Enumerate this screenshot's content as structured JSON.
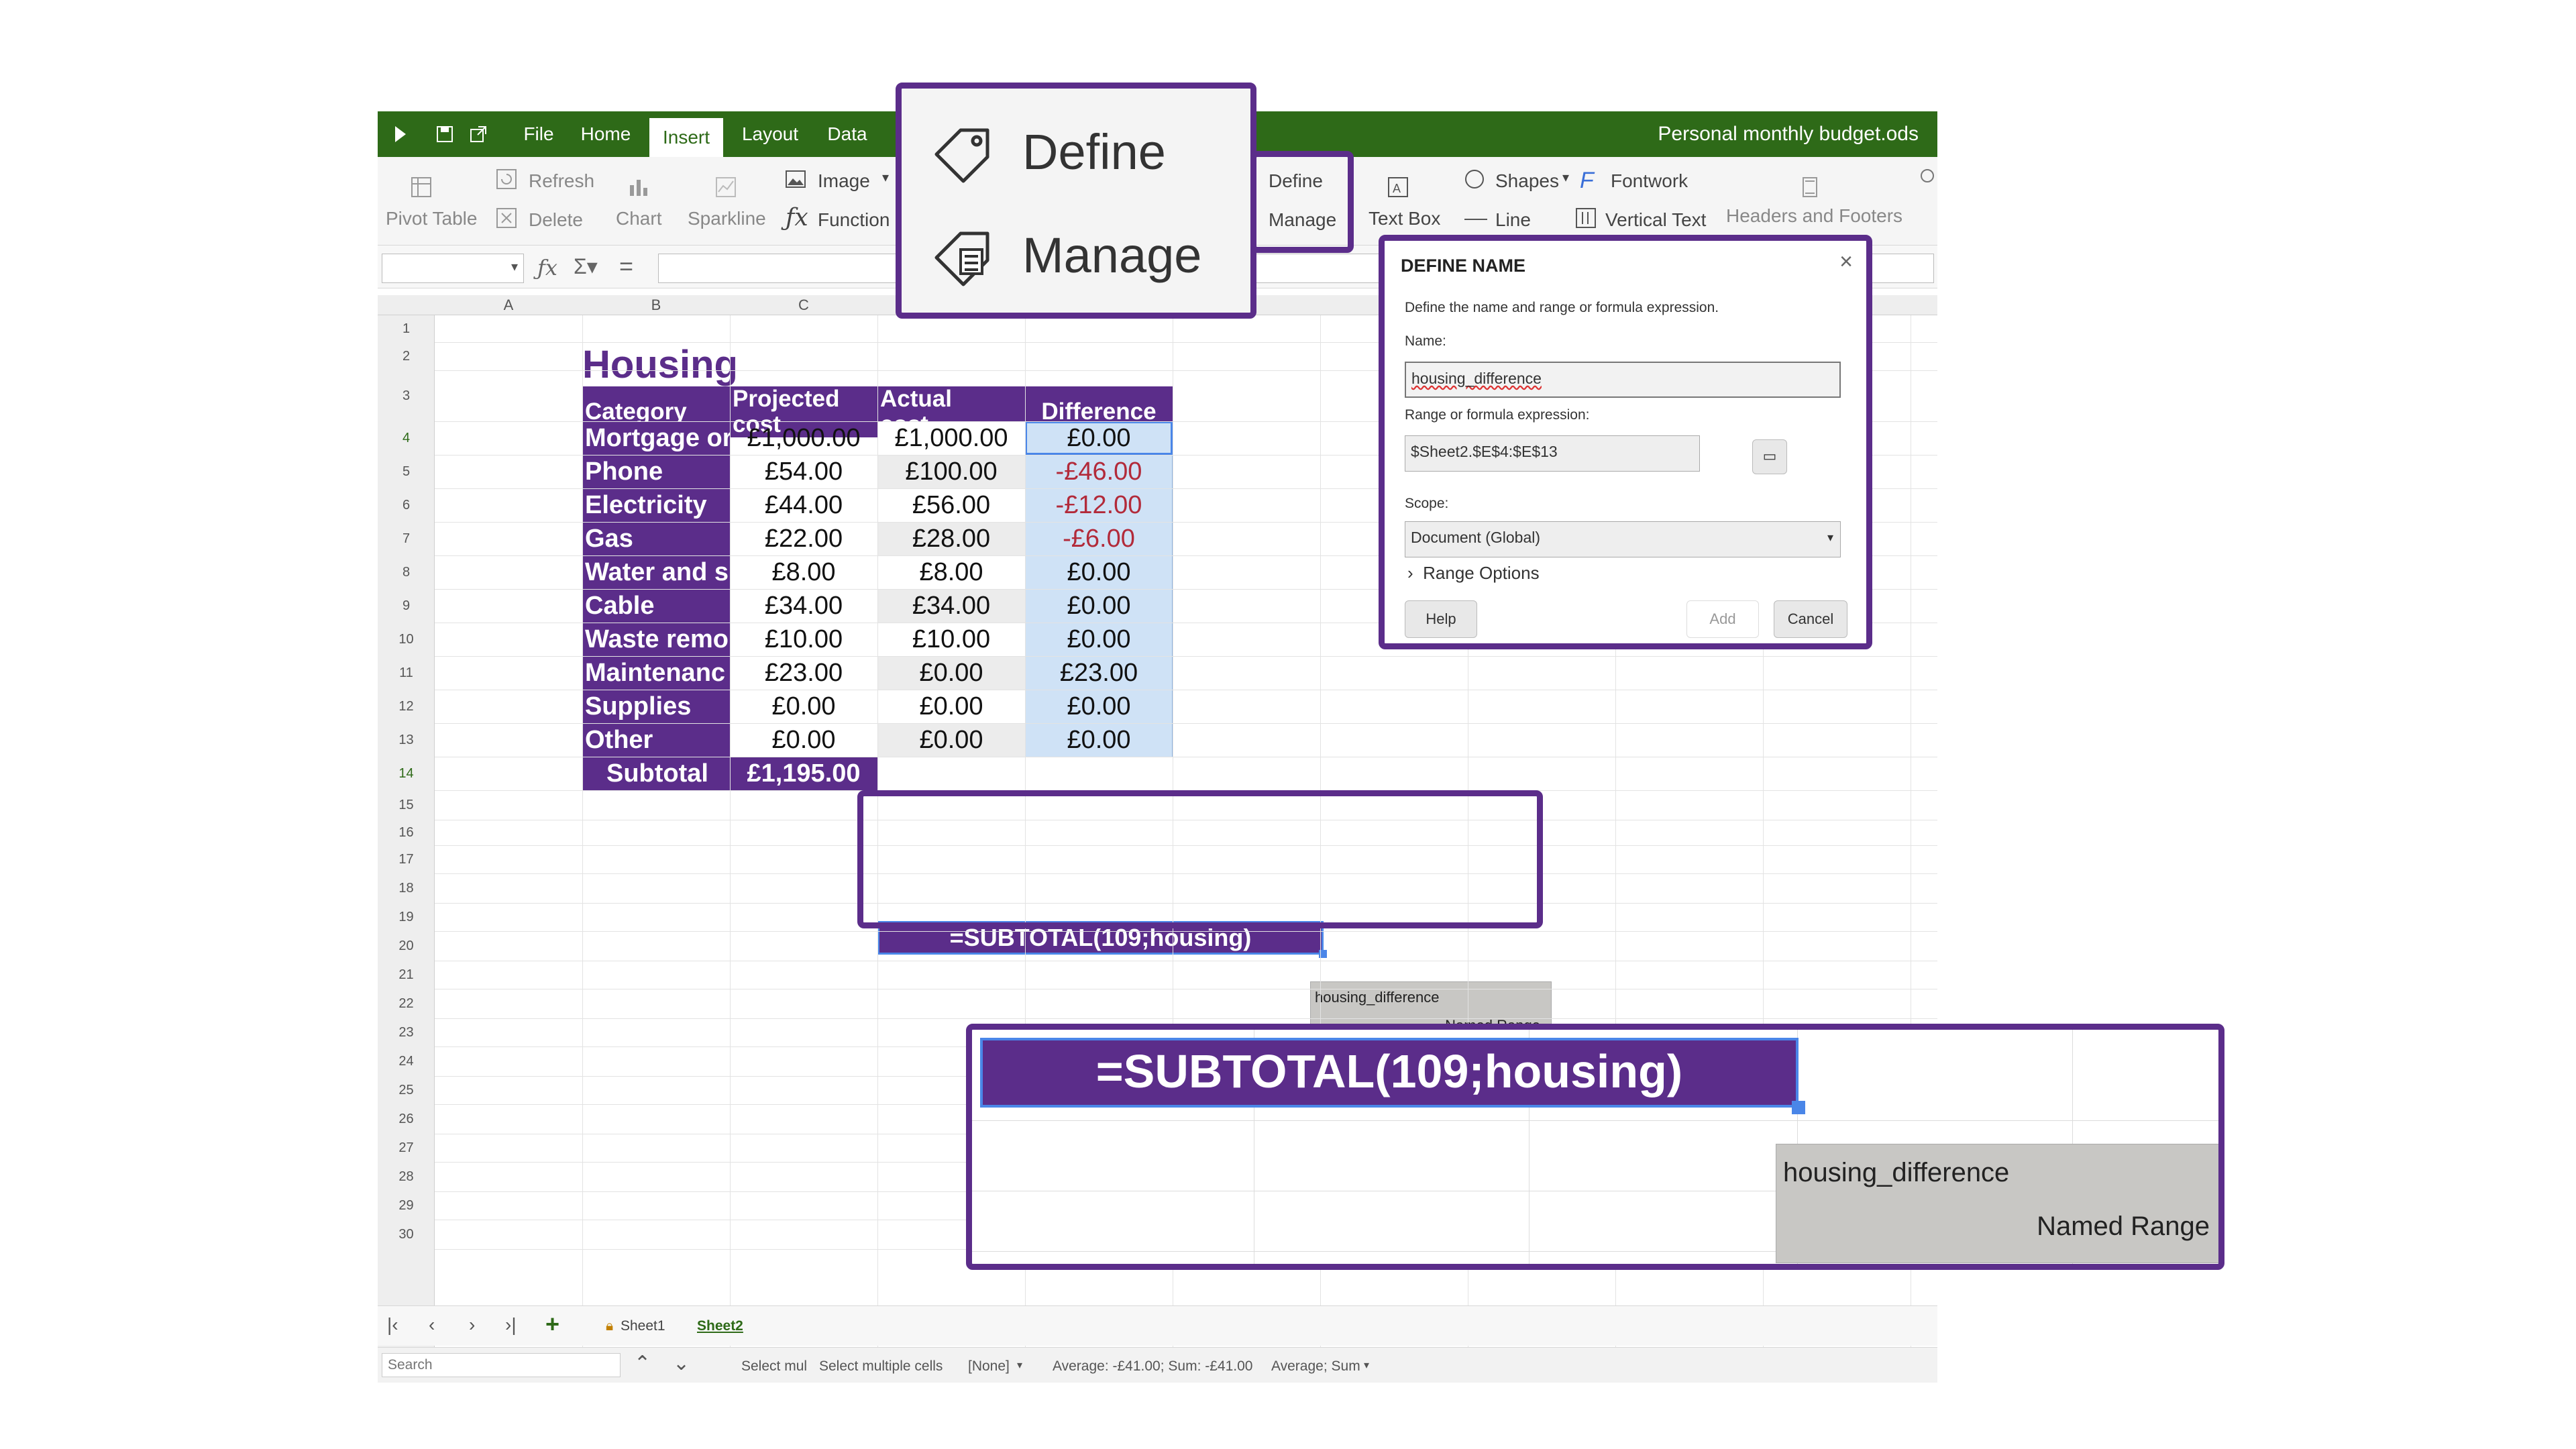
{
  "document": {
    "name": "Personal monthly budget.ods"
  },
  "menu_tabs": [
    "File",
    "Home",
    "Insert",
    "Layout",
    "Data"
  ],
  "active_tab": "Insert",
  "ribbon": {
    "pivot_table": "Pivot Table",
    "refresh": "Refresh",
    "delete": "Delete",
    "chart": "Chart",
    "sparkline": "Sparkline",
    "image": "Image",
    "function": "Function",
    "define": "Define",
    "manage": "Manage",
    "text_box": "Text Box",
    "shapes": "Shapes",
    "line": "Line",
    "fontwork": "Fontwork",
    "vertical_text": "Vertical Text",
    "headers_footers": "Headers and Footers"
  },
  "columns": [
    "A",
    "B",
    "C"
  ],
  "rows": [
    "1",
    "2",
    "3",
    "4",
    "5",
    "6",
    "7",
    "8",
    "9",
    "10",
    "11",
    "12",
    "13",
    "14",
    "15",
    "16",
    "17",
    "18",
    "19",
    "20",
    "21",
    "22",
    "23",
    "24",
    "25",
    "26",
    "27",
    "28",
    "29",
    "30"
  ],
  "sheet": {
    "title": "Housing",
    "headers": [
      "Category",
      "Projected cost",
      "Actual cost",
      "Difference"
    ],
    "header_lines": [
      [
        "Category"
      ],
      [
        "Projected",
        "cost"
      ],
      [
        "Actual",
        "cost"
      ],
      [
        "Difference"
      ]
    ],
    "data_rows": [
      {
        "category": "Mortgage or",
        "projected": "£1,000.00",
        "actual": "£1,000.00",
        "difference": "£0.00",
        "negative": false
      },
      {
        "category": "Phone",
        "projected": "£54.00",
        "actual": "£100.00",
        "difference": "-£46.00",
        "negative": true
      },
      {
        "category": "Electricity",
        "projected": "£44.00",
        "actual": "£56.00",
        "difference": "-£12.00",
        "negative": true
      },
      {
        "category": "Gas",
        "projected": "£22.00",
        "actual": "£28.00",
        "difference": "-£6.00",
        "negative": true
      },
      {
        "category": "Water and s",
        "projected": "£8.00",
        "actual": "£8.00",
        "difference": "£0.00",
        "negative": false
      },
      {
        "category": "Cable",
        "projected": "£34.00",
        "actual": "£34.00",
        "difference": "£0.00",
        "negative": false
      },
      {
        "category": "Waste remo",
        "projected": "£10.00",
        "actual": "£10.00",
        "difference": "£0.00",
        "negative": false
      },
      {
        "category": "Maintenanc",
        "projected": "£23.00",
        "actual": "£0.00",
        "difference": "£23.00",
        "negative": false
      },
      {
        "category": "Supplies",
        "projected": "£0.00",
        "actual": "£0.00",
        "difference": "£0.00",
        "negative": false
      },
      {
        "category": "Other",
        "projected": "£0.00",
        "actual": "£0.00",
        "difference": "£0.00",
        "negative": false
      }
    ],
    "subtotal_label": "Subtotal",
    "subtotal_projected": "£1,195.00"
  },
  "formula": "=SUBTOTAL(109;housing)",
  "autocomplete": {
    "name": "housing_difference",
    "type": "Named Range"
  },
  "named_ranges_menu": {
    "define": "Define",
    "manage": "Manage"
  },
  "define_name_dialog": {
    "title": "DEFINE NAME",
    "description": "Define the name and range or formula expression.",
    "name_label": "Name:",
    "name_value": "housing_difference",
    "range_label": "Range or formula expression:",
    "range_value": "$Sheet2.$E$4:$E$13",
    "scope_label": "Scope:",
    "scope_value": "Document (Global)",
    "range_options": "Range Options",
    "help": "Help",
    "add": "Add",
    "cancel": "Cancel"
  },
  "sheet_tabs": [
    "Sheet1",
    "Sheet2"
  ],
  "active_sheet": "Sheet2",
  "status": {
    "search_placeholder": "Search",
    "select_short": "Select mul",
    "select_multiple": "Select multiple cells",
    "language": "[None]",
    "summary": "Average: -£41.00; Sum: -£41.00",
    "functions": "Average; Sum"
  },
  "colors": {
    "brand_green": "#2e6a18",
    "table_purple": "#5b2d8a",
    "difference_fill": "#cfe2f6",
    "negative_red": "#b22a3a"
  }
}
